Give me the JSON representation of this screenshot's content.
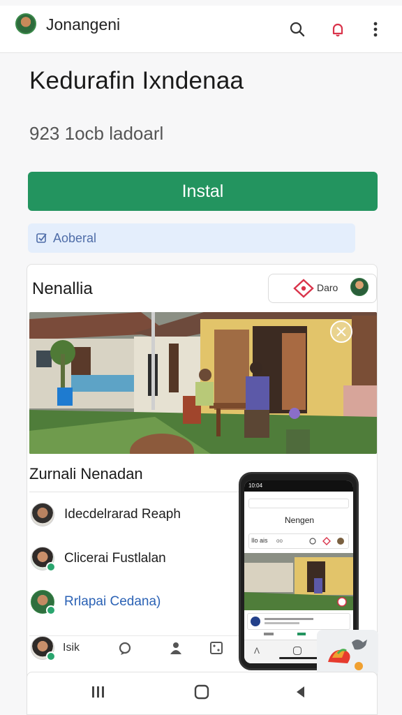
{
  "header": {
    "app_name": "Jonangeni",
    "search_icon": "search-icon",
    "notification_icon": "bell-icon",
    "more_icon": "more-vertical-icon"
  },
  "main": {
    "title": "Kedurafin Ixndenaa",
    "downloads": "923 1ocb ladoarl",
    "install_label": "Instal",
    "chip_label": "Aoberal"
  },
  "card": {
    "title": "Nenallia",
    "pill_text": "Daro",
    "section_title": "Zurnali Nenadan",
    "rows": [
      {
        "label": "Idecdelrarad Reaph"
      },
      {
        "label": "Clicerai Fustlalan"
      },
      {
        "label": "Rrlapai Cedana)"
      }
    ],
    "bottom_tab_label": "Isik"
  },
  "phone": {
    "status_time": "10:04",
    "app_title": "Nengen",
    "tab_label": "Ilo ais",
    "tab_label_2": "oo"
  },
  "colors": {
    "install_green": "#23945f",
    "chip_bg": "#e4eefc",
    "accent_red": "#d9334a",
    "link_blue": "#2b62b5"
  }
}
